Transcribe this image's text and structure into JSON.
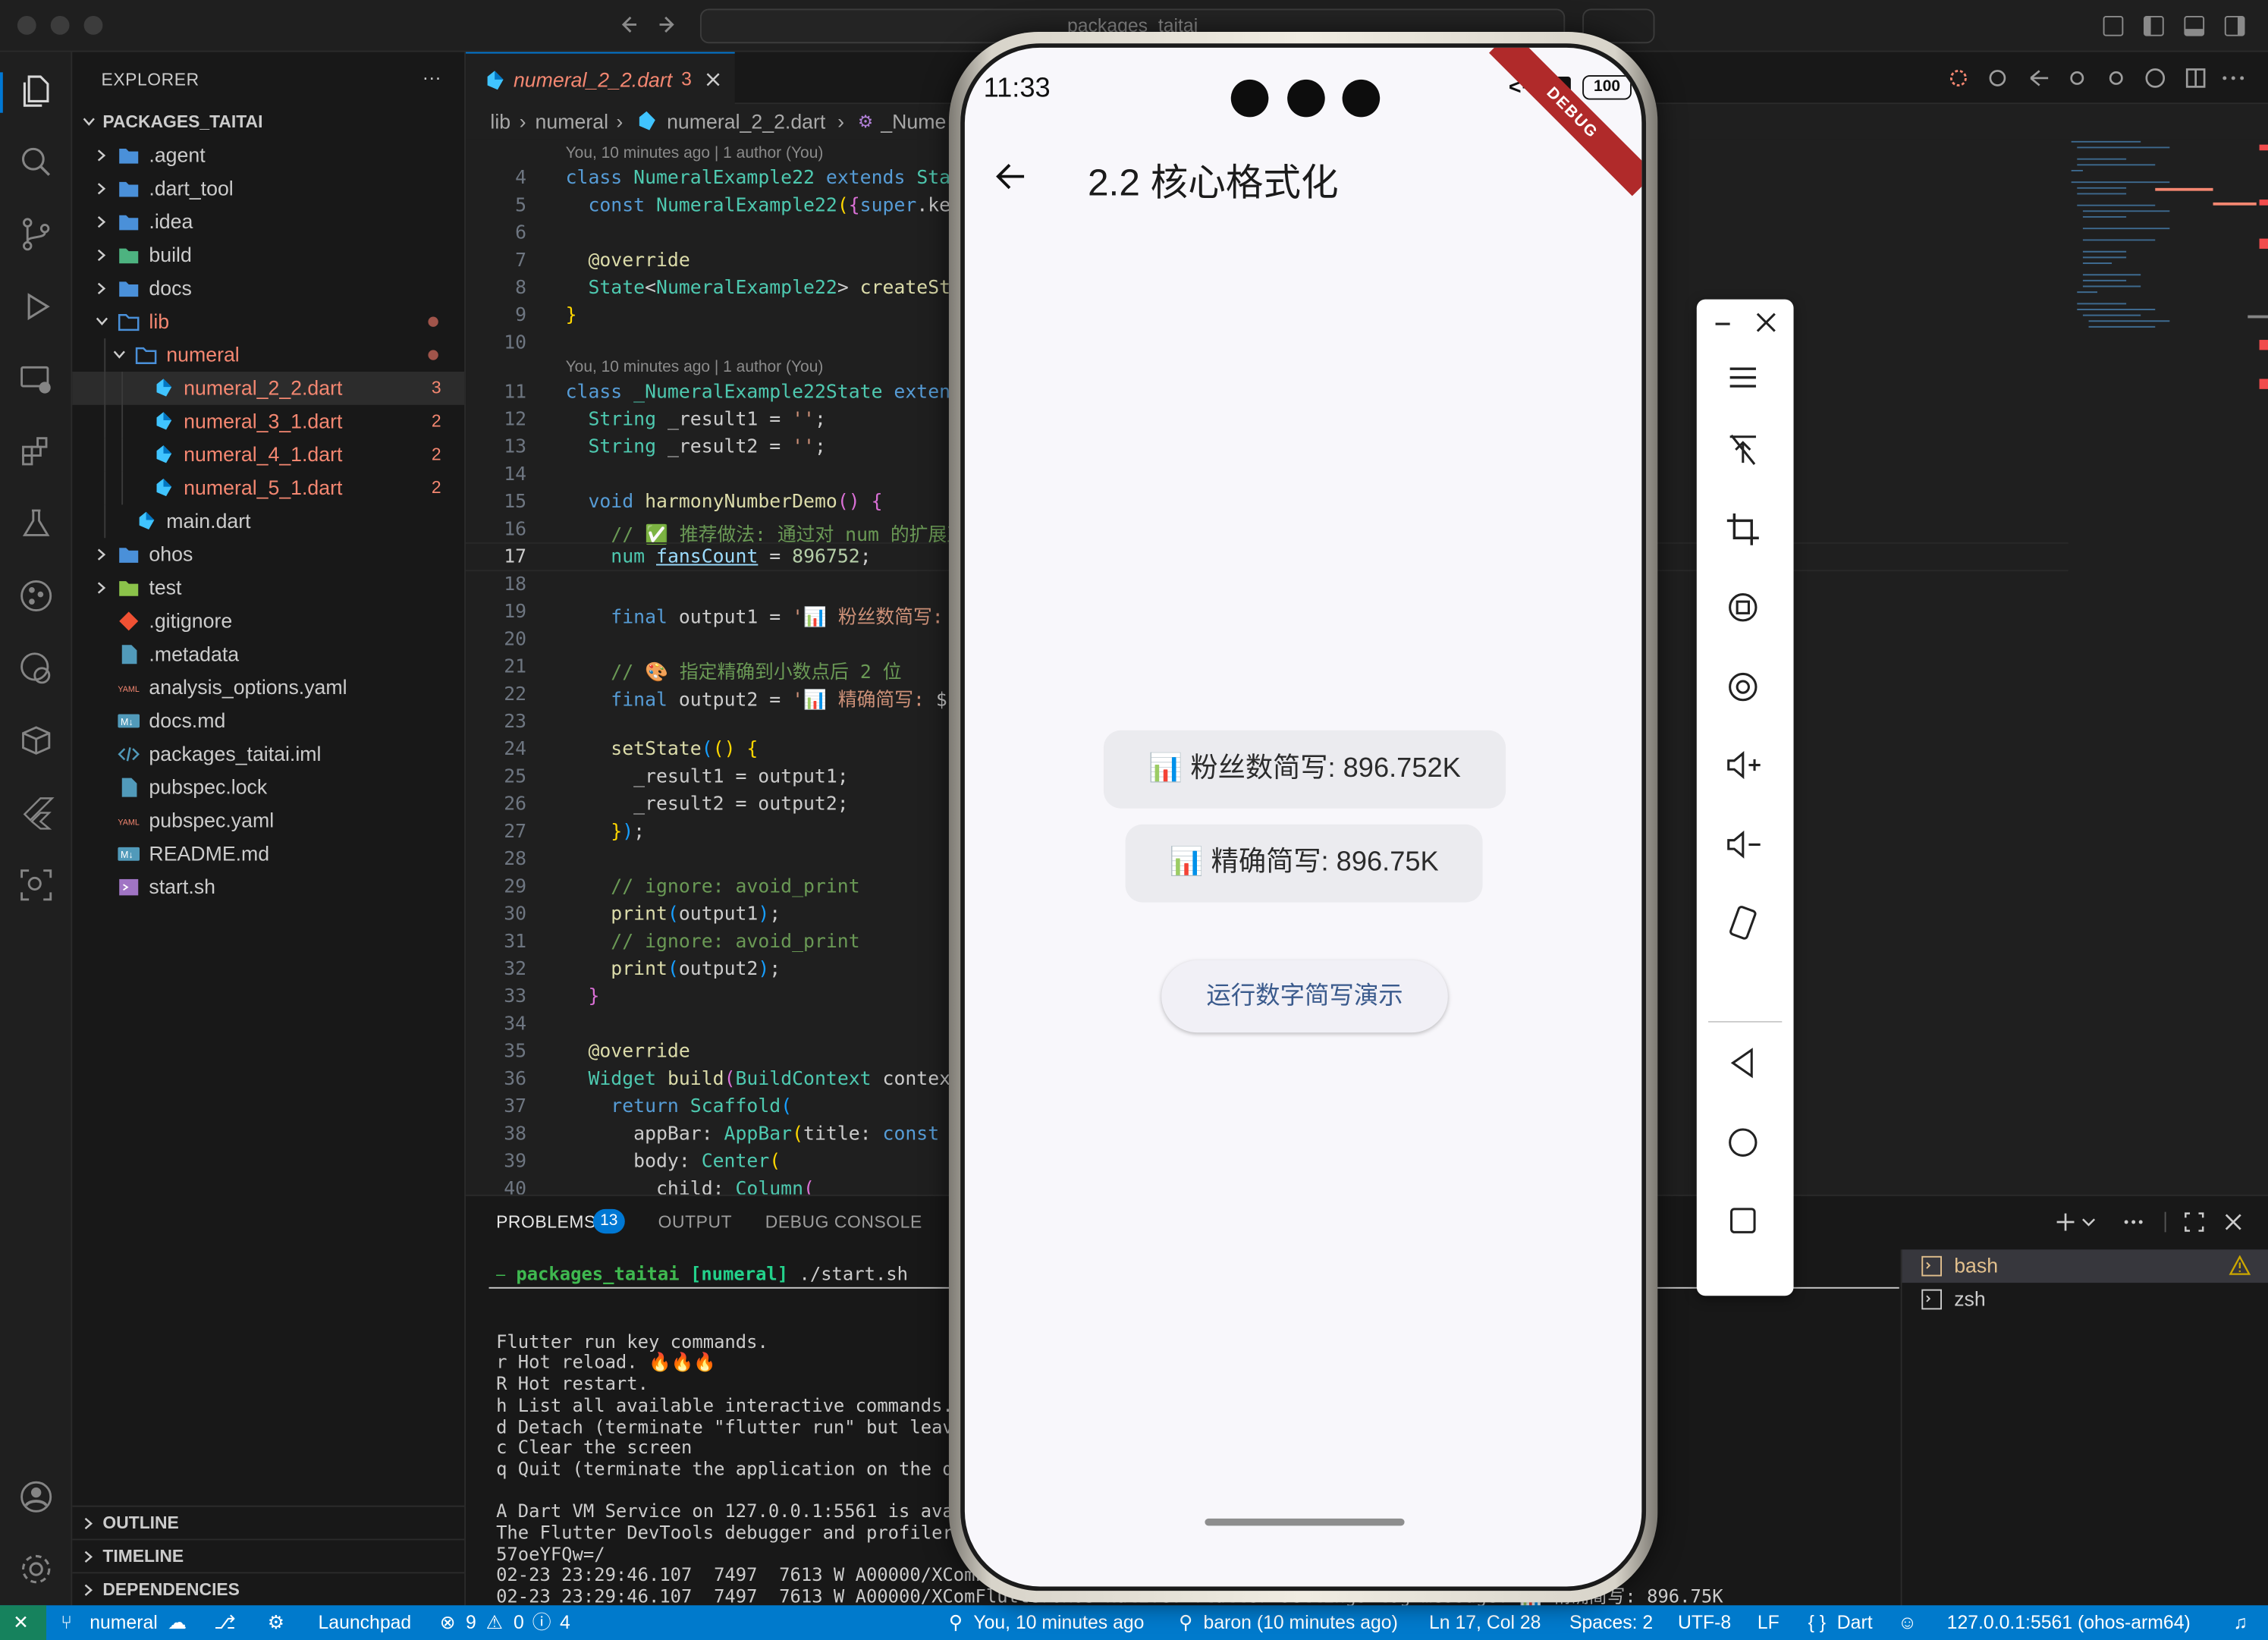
{
  "titlebar": {
    "command_center": "packages_taitai"
  },
  "explorer": {
    "header": "EXPLORER",
    "more": "···",
    "root": "PACKAGES_TAITAI",
    "items": [
      {
        "label": ".agent",
        "kind": "folder"
      },
      {
        "label": ".dart_tool",
        "kind": "folder"
      },
      {
        "label": ".idea",
        "kind": "folder"
      },
      {
        "label": "build",
        "kind": "folder-build"
      },
      {
        "label": "docs",
        "kind": "folder"
      },
      {
        "label": "lib",
        "kind": "folder-open"
      },
      {
        "label": "numeral",
        "kind": "folder-open"
      },
      {
        "label": "numeral_2_2.dart",
        "kind": "dart",
        "badge": "3"
      },
      {
        "label": "numeral_3_1.dart",
        "kind": "dart",
        "badge": "2"
      },
      {
        "label": "numeral_4_1.dart",
        "kind": "dart",
        "badge": "2"
      },
      {
        "label": "numeral_5_1.dart",
        "kind": "dart",
        "badge": "2"
      },
      {
        "label": "main.dart",
        "kind": "dart"
      },
      {
        "label": "ohos",
        "kind": "folder"
      },
      {
        "label": "test",
        "kind": "folder-test"
      },
      {
        "label": ".gitignore",
        "kind": "git"
      },
      {
        "label": ".metadata",
        "kind": "file"
      },
      {
        "label": "analysis_options.yaml",
        "kind": "yaml"
      },
      {
        "label": "docs.md",
        "kind": "md"
      },
      {
        "label": "packages_taitai.iml",
        "kind": "xml"
      },
      {
        "label": "pubspec.lock",
        "kind": "file"
      },
      {
        "label": "pubspec.yaml",
        "kind": "yaml"
      },
      {
        "label": "README.md",
        "kind": "md"
      },
      {
        "label": "start.sh",
        "kind": "sh"
      }
    ],
    "sections": [
      "OUTLINE",
      "TIMELINE",
      "DEPENDENCIES"
    ]
  },
  "tab": {
    "label": "numeral_2_2.dart",
    "badge": "3"
  },
  "breadcrumbs": {
    "a": "lib",
    "b": "numeral",
    "c": "numeral_2_2.dart",
    "d": "_Nume"
  },
  "editor": {
    "blame1": "You, 10 minutes ago | 1 author (You)",
    "blame2": "You, 10 minutes ago | 1 author (You)",
    "ghost": "Yo",
    "line_numbers": [
      "4",
      "5",
      "6",
      "7",
      "8",
      "9",
      "10",
      "11",
      "12",
      "13",
      "14",
      "15",
      "16",
      "17",
      "18",
      "19",
      "20",
      "21",
      "22",
      "23",
      "24",
      "25",
      "26",
      "27",
      "28",
      "29",
      "30",
      "31",
      "32",
      "33",
      "34",
      "35",
      "36",
      "37",
      "38",
      "39",
      "40"
    ]
  },
  "panel": {
    "tabs": {
      "problems": "PROBLEMS",
      "problems_count": "13",
      "output": "OUTPUT",
      "debug": "DEBUG CONSOLE"
    },
    "prompt": {
      "dir": "packages_taitai",
      "branch": "[numeral]",
      "cmd": "./start.sh"
    },
    "terminal_lines": [
      "Flutter run key commands.",
      "r Hot reload. 🔥🔥🔥",
      "R Hot restart.",
      "h List all available interactive commands.",
      "d Detach (terminate \"flutter run\" but leav",
      "c Clear the screen",
      "q Quit (terminate the application on the d",
      "",
      "A Dart VM Service on 127.0.0.1:5561 is ava",
      "The Flutter DevTools debugger and profiler                                       //127.0.0.1:59659/3le",
      "57oeYFQw=/",
      "02-23 23:29:46.107  7497  7613 W A00000/XComF                                  : 896.752K",
      "02-23 23:29:46.107  7497  7613 W A00000/XComFlutterOHOS_Native: flutter settings log message: 📊 精确简写: 896.75K"
    ],
    "term_instances": [
      "bash",
      "zsh"
    ]
  },
  "phone": {
    "time": "11:33",
    "battery": "100",
    "debug_banner": "DEBUG",
    "app_title": "2.2 核心格式化",
    "result1": "📊 粉丝数简写: 896.752K",
    "result2": "📊 精确简写: 896.75K",
    "button": "运行数字简写演示"
  },
  "statusbar": {
    "branch": "numeral",
    "launchpad": "Launchpad",
    "errors": "9",
    "warnings": "0",
    "infos": "4",
    "blame": "You, 10 minutes ago",
    "baron": "baron (10 minutes ago)",
    "position": "Ln 17, Col 28",
    "spaces": "Spaces: 2",
    "encoding": "UTF-8",
    "eol": "LF",
    "language": "Dart",
    "vm": "127.0.0.1:5561 (ohos-arm64)"
  },
  "colors": {
    "accent": "#0078d4",
    "status": "#007acc",
    "error": "#f48771",
    "dart": "#40c4ff"
  }
}
